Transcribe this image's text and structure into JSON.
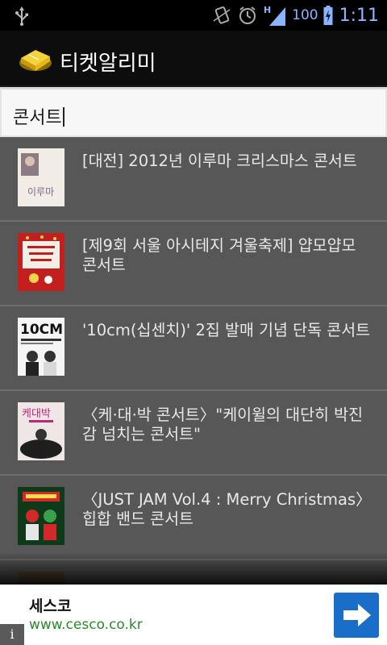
{
  "status_bar": {
    "battery_level": "100",
    "time": "1:11",
    "network_type": "H",
    "icons": [
      "usb-icon",
      "vibrate-icon",
      "alarm-icon",
      "signal-icon",
      "battery-charging-icon"
    ]
  },
  "app": {
    "title": "티켓알리미",
    "icon": "ticket-icon"
  },
  "search": {
    "value": "콘서트"
  },
  "results": [
    {
      "title": "[대전] 2012년 이루마 크리스마스 콘서트",
      "poster_text": "이루마",
      "poster_colors": [
        "#f2ece6",
        "#7a6a8a"
      ]
    },
    {
      "title": "[제9회 서울 아시테지 겨울축제] 얍모얍모 콘서트",
      "poster_text": "",
      "poster_colors": [
        "#c41f1f",
        "#f5d34a"
      ]
    },
    {
      "title": "'10cm(십센치)' 2집 발매 기념 단독 콘서트",
      "poster_text": "10CM",
      "poster_colors": [
        "#f5f5f5",
        "#111111"
      ]
    },
    {
      "title": "〈케·대·박 콘서트〉\"케이윌의 대단히 박진감 넘치는 콘서트\"",
      "poster_text": "케대박",
      "poster_colors": [
        "#efe6e6",
        "#222222"
      ]
    },
    {
      "title": "〈JUST JAM Vol.4 : Merry Christmas〉 힙합 밴드 콘서트",
      "poster_text": "",
      "poster_colors": [
        "#0f3a1a",
        "#d22a2a"
      ]
    }
  ],
  "ad": {
    "title": "세스코",
    "url": "www.cesco.co.kr",
    "info_label": "i",
    "button_color": "#1a6ec9"
  },
  "colors": {
    "list_background": "#575757",
    "divider": "#6f6f6f",
    "text": "#e8e8e8",
    "status_accent": "#8ab4ff"
  }
}
